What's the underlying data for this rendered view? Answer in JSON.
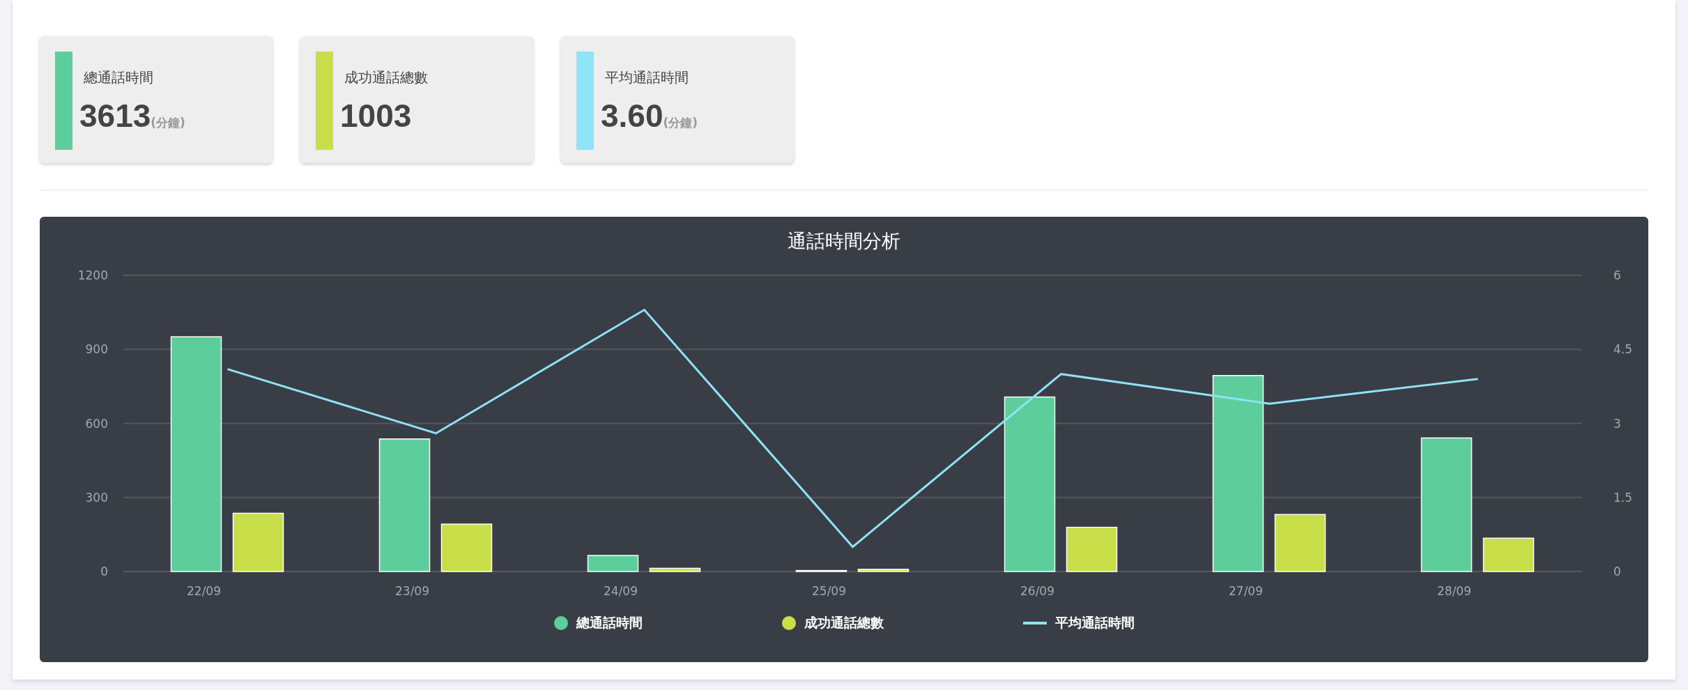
{
  "stats": [
    {
      "label": "總通話時間",
      "value": "3613",
      "unit": "(分鐘)",
      "color": "#5ccd9b"
    },
    {
      "label": "成功通話總數",
      "value": "1003",
      "color": "#c8df4a"
    },
    {
      "label": "平均通話時間",
      "value": "3.60",
      "unit": "(分鐘)",
      "color": "#8ee5f8"
    }
  ],
  "chart": {
    "chart_data": {
      "type": "bar",
      "title": "通話時間分析",
      "categories": [
        "22/09",
        "23/09",
        "24/09",
        "25/09",
        "26/09",
        "27/09",
        "28/09"
      ],
      "series": [
        {
          "name": "總通話時間",
          "color": "#5ccd9b",
          "type": "bar",
          "values": [
            951,
            537,
            65,
            4,
            707,
            794,
            541
          ]
        },
        {
          "name": "成功通話總數",
          "color": "#c8df4a",
          "type": "bar",
          "values": [
            236,
            192,
            13,
            9,
            179,
            231,
            135
          ]
        },
        {
          "name": "平均通話時間",
          "color": "#8ee3f5",
          "type": "line",
          "axis": "y2",
          "values": [
            4.1,
            2.8,
            5.3,
            0.5,
            4.0,
            3.4,
            3.9
          ]
        }
      ],
      "stacked": false,
      "grid": true,
      "ylim": [
        0,
        1200
      ],
      "yticks": [
        0,
        300,
        600,
        900,
        1200
      ],
      "y2lim": [
        0,
        6
      ],
      "y2ticks": [
        {
          "value": 0,
          "label": "0"
        },
        {
          "value": 1.5,
          "label": "1.5"
        },
        {
          "value": 3,
          "label": "3"
        },
        {
          "value": 4.5,
          "label": "4.5"
        },
        {
          "value": 6,
          "label": "6"
        }
      ]
    }
  }
}
